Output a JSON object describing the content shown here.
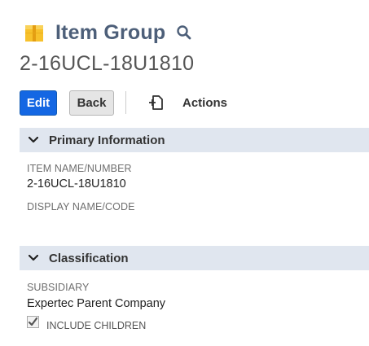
{
  "header": {
    "record_type": "Item Group",
    "record_icon": "item-group-box-icon",
    "search_icon": "search-icon",
    "record_name": "2-16UCL-18U1810"
  },
  "toolbar": {
    "edit_label": "Edit",
    "back_label": "Back",
    "actions_label": "Actions",
    "actions_icon": "actions-doc-icon"
  },
  "sections": {
    "primary": {
      "title": "Primary Information",
      "item_name_label": "ITEM NAME/NUMBER",
      "item_name_value": "2-16UCL-18U1810",
      "display_name_label": "DISPLAY NAME/CODE"
    },
    "classification": {
      "title": "Classification",
      "subsidiary_label": "SUBSIDIARY",
      "subsidiary_value": "Expertec Parent Company",
      "include_children_label": "INCLUDE CHILDREN",
      "include_children_checked": true
    }
  },
  "colors": {
    "accent_blue": "#1467e3",
    "title_color": "#4d5f79",
    "section_bg": "#e0e6ef",
    "icon_yellow": "#f7c12b"
  }
}
